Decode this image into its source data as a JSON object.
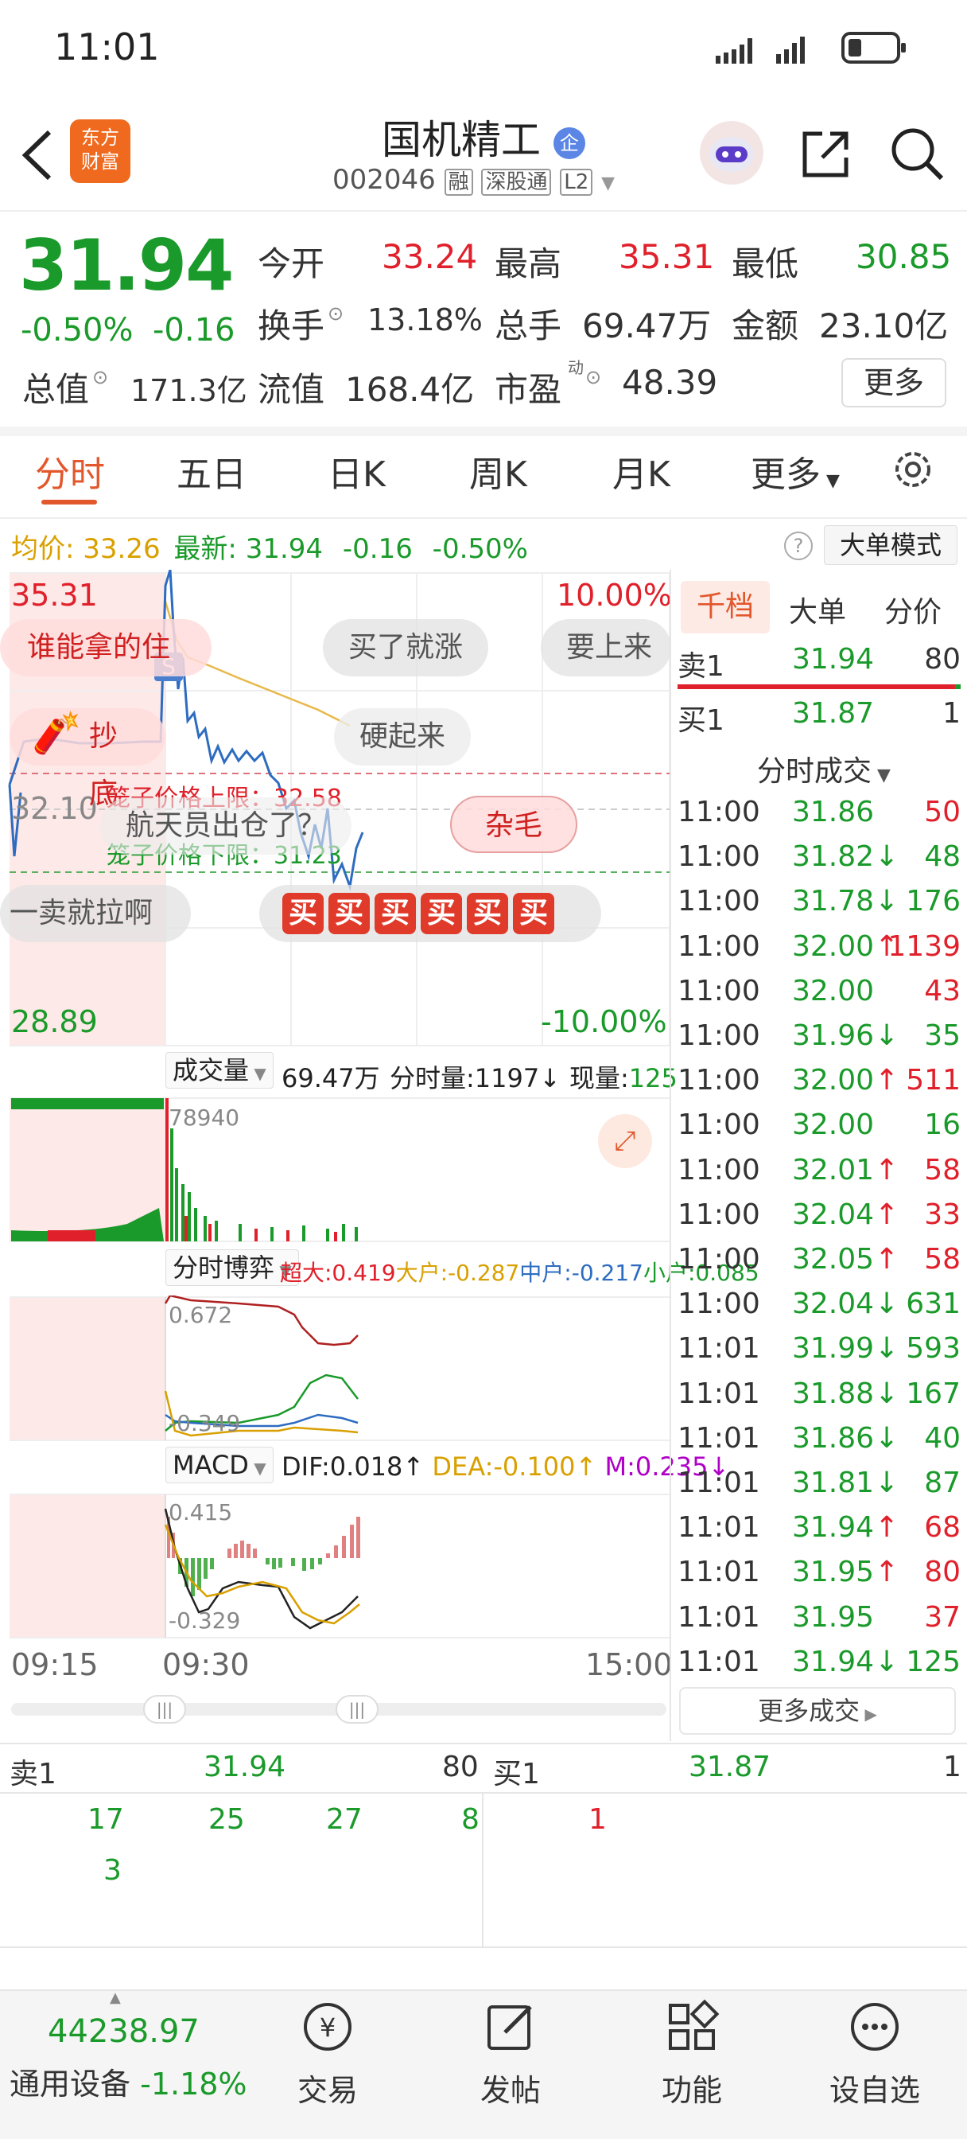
{
  "status_bar": {
    "time": "11:01"
  },
  "header": {
    "logo_line1": "东方",
    "logo_line2": "财富",
    "stock_name": "国机精工",
    "enterprise_badge": "企",
    "stock_code": "002046",
    "tags": [
      "融",
      "深股通",
      "L2"
    ]
  },
  "quote": {
    "price": "31.94",
    "change_pct": "-0.50%",
    "change": "-0.16",
    "open_label": "今开",
    "open": "33.24",
    "high_label": "最高",
    "high": "35.31",
    "low_label": "最低",
    "low": "30.85",
    "turnover_label": "换手",
    "turnover": "13.18%",
    "volume_label": "总手",
    "volume": "69.47万",
    "amount_label": "金额",
    "amount": "23.10亿",
    "mktcap_label": "总值",
    "mktcap": "171.3亿",
    "float_label": "流值",
    "float_cap": "168.4亿",
    "pe_label": "市盈",
    "pe_sup": "动",
    "pe": "48.39",
    "more_button": "更多"
  },
  "chart_tabs": [
    "分时",
    "五日",
    "日K",
    "周K",
    "月K",
    "更多"
  ],
  "info_bar": {
    "avg_label": "均价:",
    "avg": "33.26",
    "latest_label": "最新:",
    "latest": "31.94",
    "latest_change": "-0.16",
    "latest_pct": "-0.50%",
    "big_order_button": "大单模式"
  },
  "price_chart": {
    "top_price": "35.31",
    "mid_price": "32.10",
    "bottom_price": "28.89",
    "top_pct": "10.00%",
    "bottom_pct": "-10.00%",
    "upper_limit": "笼子价格上限：32.58",
    "lower_limit": "笼子价格下限：31.23"
  },
  "bubbles": [
    "谁能拿的住",
    "买了就涨",
    "要上来",
    "抄底",
    "硬起来",
    "航天员出仓了？",
    "杂毛",
    "一卖就拉啊"
  ],
  "buy_stamp": [
    "买",
    "买",
    "买",
    "买",
    "买",
    "买"
  ],
  "volume_section": {
    "label": "成交量",
    "total": "69.47万",
    "minute_vol": "分时量:1197↓",
    "current_vol_label": "现量:",
    "current_vol": "125",
    "peak": "78940"
  },
  "game_section": {
    "label": "分时博弈",
    "super_large": "超大:0.419",
    "large": "大户:-0.287",
    "medium": "中户:-0.217",
    "small": "小户:0.085",
    "top_value": "0.672",
    "bottom_value": "-0.349"
  },
  "macd_section": {
    "label": "MACD",
    "dif": "DIF:0.018↑",
    "dea": "DEA:-0.100↑",
    "m": "M:0.235↓",
    "top_value": "0.415",
    "bottom_value": "-0.329"
  },
  "time_axis": [
    "09:15",
    "09:30",
    "15:00"
  ],
  "right_panel": {
    "tabs": [
      "千档",
      "大单",
      "分价"
    ],
    "sell1": {
      "label": "卖1",
      "price": "31.94",
      "qty": "80"
    },
    "buy1": {
      "label": "买1",
      "price": "31.87",
      "qty": "1"
    },
    "trades_title": "分时成交",
    "trades": [
      {
        "time": "11:00",
        "price": "31.86",
        "qty": "50",
        "dir": "",
        "color": "red"
      },
      {
        "time": "11:00",
        "price": "31.82",
        "qty": "48",
        "dir": "↓",
        "color": "green"
      },
      {
        "time": "11:00",
        "price": "31.78",
        "qty": "176",
        "dir": "↓",
        "color": "green"
      },
      {
        "time": "11:00",
        "price": "32.00",
        "qty": "1139",
        "dir": "↑",
        "color": "red"
      },
      {
        "time": "11:00",
        "price": "32.00",
        "qty": "43",
        "dir": "",
        "color": "red"
      },
      {
        "time": "11:00",
        "price": "31.96",
        "qty": "35",
        "dir": "↓",
        "color": "green"
      },
      {
        "time": "11:00",
        "price": "32.00",
        "qty": "511",
        "dir": "↑",
        "color": "red"
      },
      {
        "time": "11:00",
        "price": "32.00",
        "qty": "16",
        "dir": "",
        "color": "green"
      },
      {
        "time": "11:00",
        "price": "32.01",
        "qty": "58",
        "dir": "↑",
        "color": "red"
      },
      {
        "time": "11:00",
        "price": "32.04",
        "qty": "33",
        "dir": "↑",
        "color": "red"
      },
      {
        "time": "11:00",
        "price": "32.05",
        "qty": "58",
        "dir": "↑",
        "color": "red"
      },
      {
        "time": "11:00",
        "price": "32.04",
        "qty": "631",
        "dir": "↓",
        "color": "green"
      },
      {
        "time": "11:01",
        "price": "31.99",
        "qty": "593",
        "dir": "↓",
        "color": "green"
      },
      {
        "time": "11:01",
        "price": "31.88",
        "qty": "167",
        "dir": "↓",
        "color": "green"
      },
      {
        "time": "11:01",
        "price": "31.86",
        "qty": "40",
        "dir": "↓",
        "color": "green"
      },
      {
        "time": "11:01",
        "price": "31.81",
        "qty": "87",
        "dir": "↓",
        "color": "green"
      },
      {
        "time": "11:01",
        "price": "31.94",
        "qty": "68",
        "dir": "↑",
        "color": "red"
      },
      {
        "time": "11:01",
        "price": "31.95",
        "qty": "80",
        "dir": "↑",
        "color": "red"
      },
      {
        "time": "11:01",
        "price": "31.95",
        "qty": "37",
        "dir": "",
        "color": "red"
      },
      {
        "time": "11:01",
        "price": "31.94",
        "qty": "125",
        "dir": "↓",
        "color": "green"
      }
    ],
    "more_trades": "更多成交"
  },
  "orderbook": {
    "sell_label": "卖1",
    "sell_price": "31.94",
    "sell_qty": "80",
    "buy_label": "买1",
    "buy_price": "31.87",
    "buy_qty": "1",
    "sell_queue_row1": [
      "17",
      "25",
      "27",
      "8"
    ],
    "sell_queue_row2": [
      "3"
    ],
    "buy_queue": [
      "1"
    ]
  },
  "bottom_nav": {
    "index_value": "44238.97",
    "index_name": "通用设备",
    "index_change": "-1.18%",
    "items": [
      "交易",
      "发帖",
      "功能",
      "设自选"
    ]
  }
}
